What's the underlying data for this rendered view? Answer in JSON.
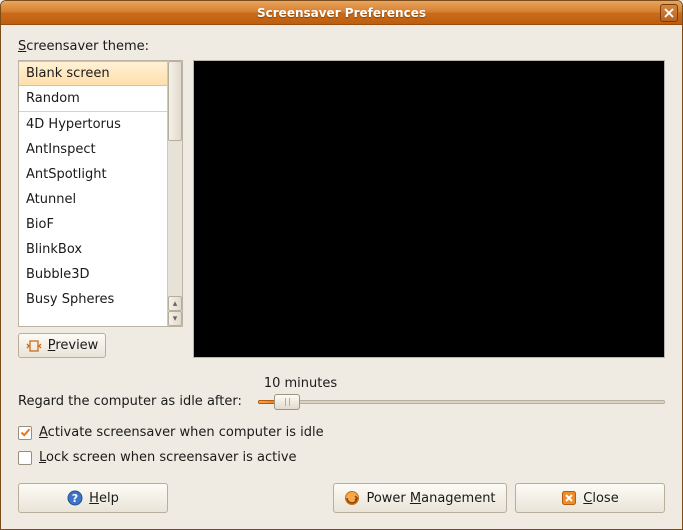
{
  "window": {
    "title": "Screensaver Preferences"
  },
  "theme": {
    "label_prefix": "S",
    "label_rest": "creensaver theme:",
    "items": [
      "Blank screen",
      "Random",
      "4D Hypertorus",
      "AntInspect",
      "AntSpotlight",
      "Atunnel",
      "BioF",
      "BlinkBox",
      "Bubble3D",
      "Busy Spheres"
    ],
    "selected_index": 0,
    "separator_after_index": 1
  },
  "preview_button": {
    "p": "P",
    "rest": "review"
  },
  "idle": {
    "label": "Regard the computer as idle after:",
    "value_text": "10 minutes"
  },
  "checks": {
    "activate": {
      "checked": true,
      "a": "A",
      "rest": "ctivate screensaver when computer is idle"
    },
    "lock": {
      "checked": false,
      "l": "L",
      "rest": "ock screen when screensaver is active"
    }
  },
  "buttons": {
    "help": {
      "h": "H",
      "rest": "elp"
    },
    "power": {
      "pre": "Power ",
      "m": "M",
      "rest": "anagement"
    },
    "close": {
      "c": "C",
      "rest": "lose"
    }
  }
}
